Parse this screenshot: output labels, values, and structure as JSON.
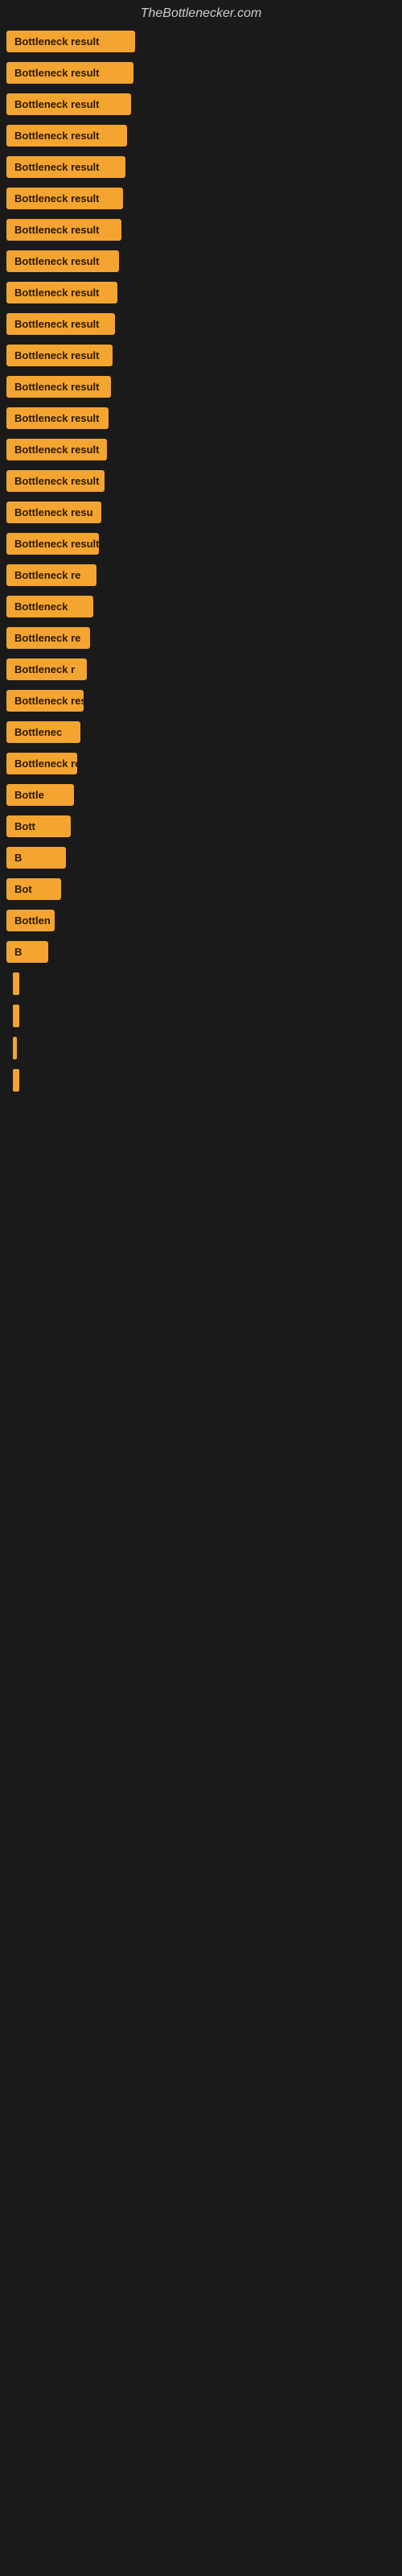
{
  "site": {
    "title": "TheBottlenecker.com"
  },
  "items": [
    {
      "label": "Bottleneck result",
      "width_class": "w-full"
    },
    {
      "label": "Bottleneck result",
      "width_class": "w-1"
    },
    {
      "label": "Bottleneck result",
      "width_class": "w-2"
    },
    {
      "label": "Bottleneck result",
      "width_class": "w-3"
    },
    {
      "label": "Bottleneck result",
      "width_class": "w-4"
    },
    {
      "label": "Bottleneck result",
      "width_class": "w-5"
    },
    {
      "label": "Bottleneck result",
      "width_class": "w-6"
    },
    {
      "label": "Bottleneck result",
      "width_class": "w-7"
    },
    {
      "label": "Bottleneck result",
      "width_class": "w-8"
    },
    {
      "label": "Bottleneck result",
      "width_class": "w-9"
    },
    {
      "label": "Bottleneck result",
      "width_class": "w-10"
    },
    {
      "label": "Bottleneck result",
      "width_class": "w-11"
    },
    {
      "label": "Bottleneck result",
      "width_class": "w-12"
    },
    {
      "label": "Bottleneck result",
      "width_class": "w-13"
    },
    {
      "label": "Bottleneck result",
      "width_class": "w-14"
    },
    {
      "label": "Bottleneck resu",
      "width_class": "w-15"
    },
    {
      "label": "Bottleneck result",
      "width_class": "w-16"
    },
    {
      "label": "Bottleneck re",
      "width_class": "w-17"
    },
    {
      "label": "Bottleneck",
      "width_class": "w-18"
    },
    {
      "label": "Bottleneck re",
      "width_class": "w-19"
    },
    {
      "label": "Bottleneck r",
      "width_class": "w-20"
    },
    {
      "label": "Bottleneck resu",
      "width_class": "w-21"
    },
    {
      "label": "Bottlenec",
      "width_class": "w-22"
    },
    {
      "label": "Bottleneck re",
      "width_class": "w-23"
    },
    {
      "label": "Bottle",
      "width_class": "w-24"
    },
    {
      "label": "Bott",
      "width_class": "w-25"
    },
    {
      "label": "B",
      "width_class": "w-26"
    },
    {
      "label": "Bot",
      "width_class": "w-27"
    },
    {
      "label": "Bottlen",
      "width_class": "w-28"
    },
    {
      "label": "B",
      "width_class": "w-29"
    }
  ]
}
